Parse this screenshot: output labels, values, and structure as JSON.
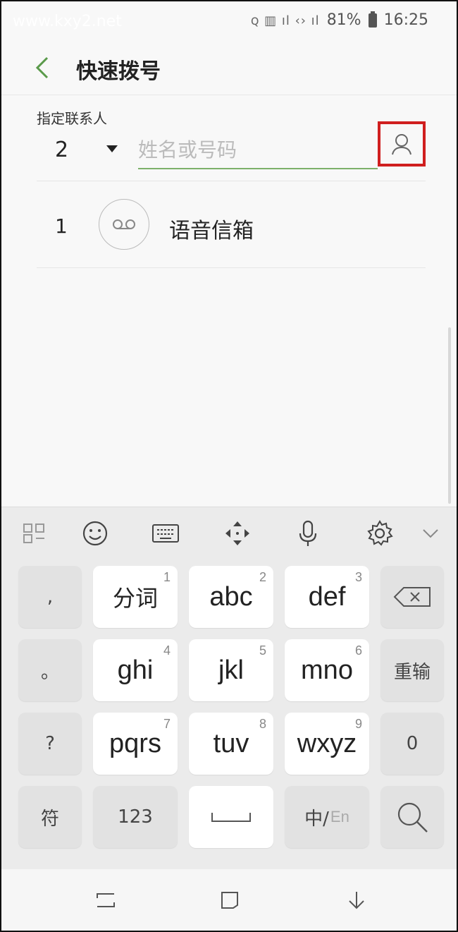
{
  "status": {
    "watermark": "www.kxy2.net",
    "battery": "81%",
    "time": "16:25",
    "signal_icons": "ꞯ ▥ ıl ‹› ıl"
  },
  "header": {
    "title": "快速拨号"
  },
  "form": {
    "label": "指定联系人",
    "slot_number": "2",
    "input_placeholder": "姓名或号码",
    "input_value": ""
  },
  "speed_dial_list": [
    {
      "number": "1",
      "label": "语音信箱",
      "icon": "voicemail-icon"
    }
  ],
  "keyboard": {
    "toolbar_icons": [
      "apps-icon",
      "emoji-icon",
      "keyboard-icon",
      "cursor-move-icon",
      "mic-icon",
      "gear-icon",
      "chevron-down-icon"
    ],
    "keys": {
      "comma": ",",
      "fenci": "分词",
      "fenci_num": "1",
      "abc": "abc",
      "abc_num": "2",
      "def": "def",
      "def_num": "3",
      "period": "。",
      "ghi": "ghi",
      "ghi_num": "4",
      "jkl": "jkl",
      "jkl_num": "5",
      "mno": "mno",
      "mno_num": "6",
      "reenter": "重输",
      "question": "?",
      "pqrs": "pqrs",
      "pqrs_num": "7",
      "tuv": "tuv",
      "tuv_num": "8",
      "wxyz": "wxyz",
      "wxyz_num": "9",
      "zero": "0",
      "symbols": "符",
      "numbers": "123",
      "lang_zh": "中/",
      "lang_en": "En"
    }
  },
  "colors": {
    "accent_green": "#7cb06a",
    "highlight_red": "#d01f1f"
  }
}
